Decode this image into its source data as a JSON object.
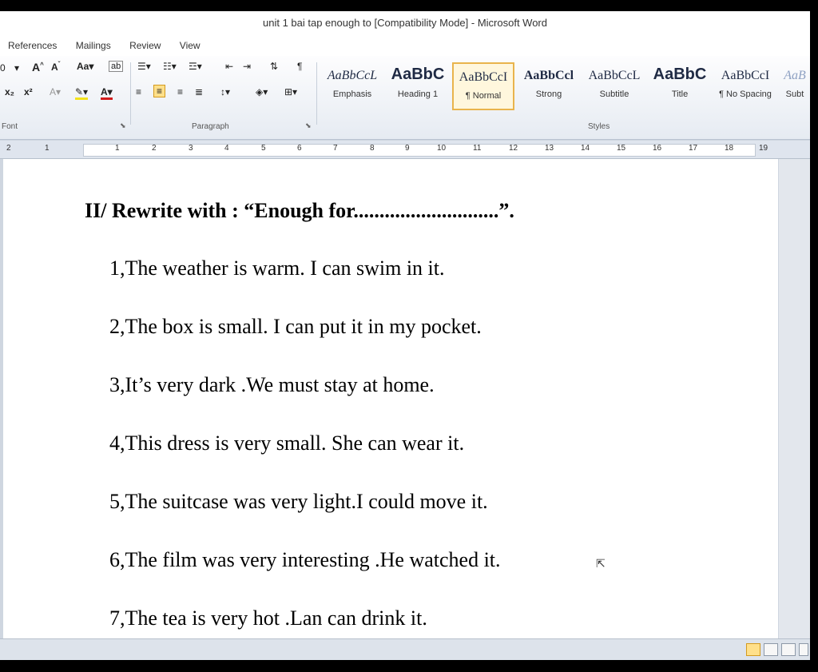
{
  "window": {
    "title": "unit 1 bai tap enough to [Compatibility Mode] - Microsoft Word"
  },
  "tabs": [
    "References",
    "Mailings",
    "Review",
    "View"
  ],
  "ribbon": {
    "groups": {
      "font": "Font",
      "paragraph": "Paragraph",
      "styles": "Styles"
    },
    "font_size_fragment": "0",
    "styles": [
      {
        "sample": "AaBbCcL",
        "label": "Emphasis"
      },
      {
        "sample": "AaBbC",
        "label": "Heading 1"
      },
      {
        "sample": "AaBbCcI",
        "label": "¶ Normal"
      },
      {
        "sample": "AaBbCcl",
        "label": "Strong"
      },
      {
        "sample": "AaBbCcL",
        "label": "Subtitle"
      },
      {
        "sample": "AaBbC",
        "label": "Title"
      },
      {
        "sample": "AaBbCcI",
        "label": "¶ No Spacing"
      },
      {
        "sample": "AaB",
        "label": "Subt"
      }
    ]
  },
  "ruler": {
    "labels": [
      "2",
      "1",
      "1",
      "2",
      "3",
      "4",
      "5",
      "6",
      "7",
      "8",
      "9",
      "10",
      "11",
      "12",
      "13",
      "14",
      "15",
      "16",
      "17",
      "18",
      "19"
    ]
  },
  "document": {
    "heading": "II/ Rewrite with : “Enough for............................”.",
    "lines": [
      "1,The weather is warm. I can swim in it.",
      "2,The box is small. I can put it in my pocket.",
      "3,It’s very dark .We must stay at home.",
      "4,This dress is very small. She can wear it.",
      "5,The suitcase was very light.I could move it.",
      "6,The film was very interesting .He watched it.",
      "7,The tea is very hot .Lan can drink it."
    ]
  },
  "icons": {
    "cursor": "mouse-cursor-icon"
  }
}
